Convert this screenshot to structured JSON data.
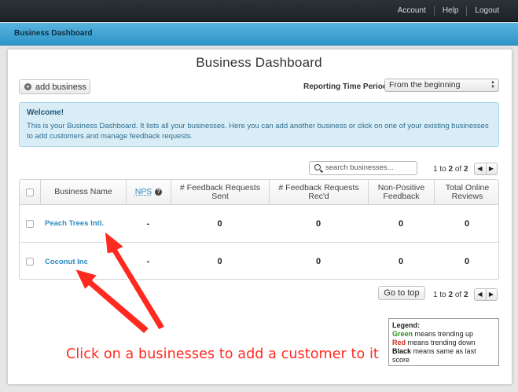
{
  "topnav": {
    "account": "Account",
    "help": "Help",
    "logout": "Logout"
  },
  "subheader": {
    "title": "Business Dashboard"
  },
  "page": {
    "title": "Business Dashboard"
  },
  "toolbar": {
    "add_business": "add business",
    "reporting_label": "Reporting Time Period",
    "reporting_value": "From the beginning"
  },
  "welcome": {
    "title": "Welcome!",
    "text": "This is your Business Dashboard. It lists all your businesses. Here you can add another business or click on one of your existing businesses to add customers and manage feedback requests."
  },
  "search": {
    "placeholder": "search businesses..."
  },
  "pagination": {
    "from": "1",
    "to_word": "to",
    "to": "2",
    "of_word": "of",
    "total": "2",
    "prev": "◀",
    "next": "▶"
  },
  "table": {
    "headers": [
      "Business Name",
      "NPS",
      "# Feedback Requests Sent",
      "# Feedback Requests Rec'd",
      "Non-Positive Feedback",
      "Total Online Reviews"
    ],
    "rows": [
      {
        "name": "Peach Trees Intl.",
        "nps": "-",
        "sent": "0",
        "recd": "0",
        "nonpositive": "0",
        "reviews": "0"
      },
      {
        "name": "Coconut Inc",
        "nps": "-",
        "sent": "0",
        "recd": "0",
        "nonpositive": "0",
        "reviews": "0"
      }
    ]
  },
  "go_to_top": "Go to top",
  "legend": {
    "title": "Legend:",
    "green": "Green",
    "green_text": " means trending up",
    "red": "Red",
    "red_text": " means trending down",
    "black": "Black",
    "black_text": " means same as last score"
  },
  "annotation": {
    "text": "Click on a businesses to add a customer to it",
    "color": "#ff2a1f"
  },
  "colors": {
    "accent": "#2e95c9",
    "link": "#2a8bc2",
    "topbar": "#22292c"
  }
}
